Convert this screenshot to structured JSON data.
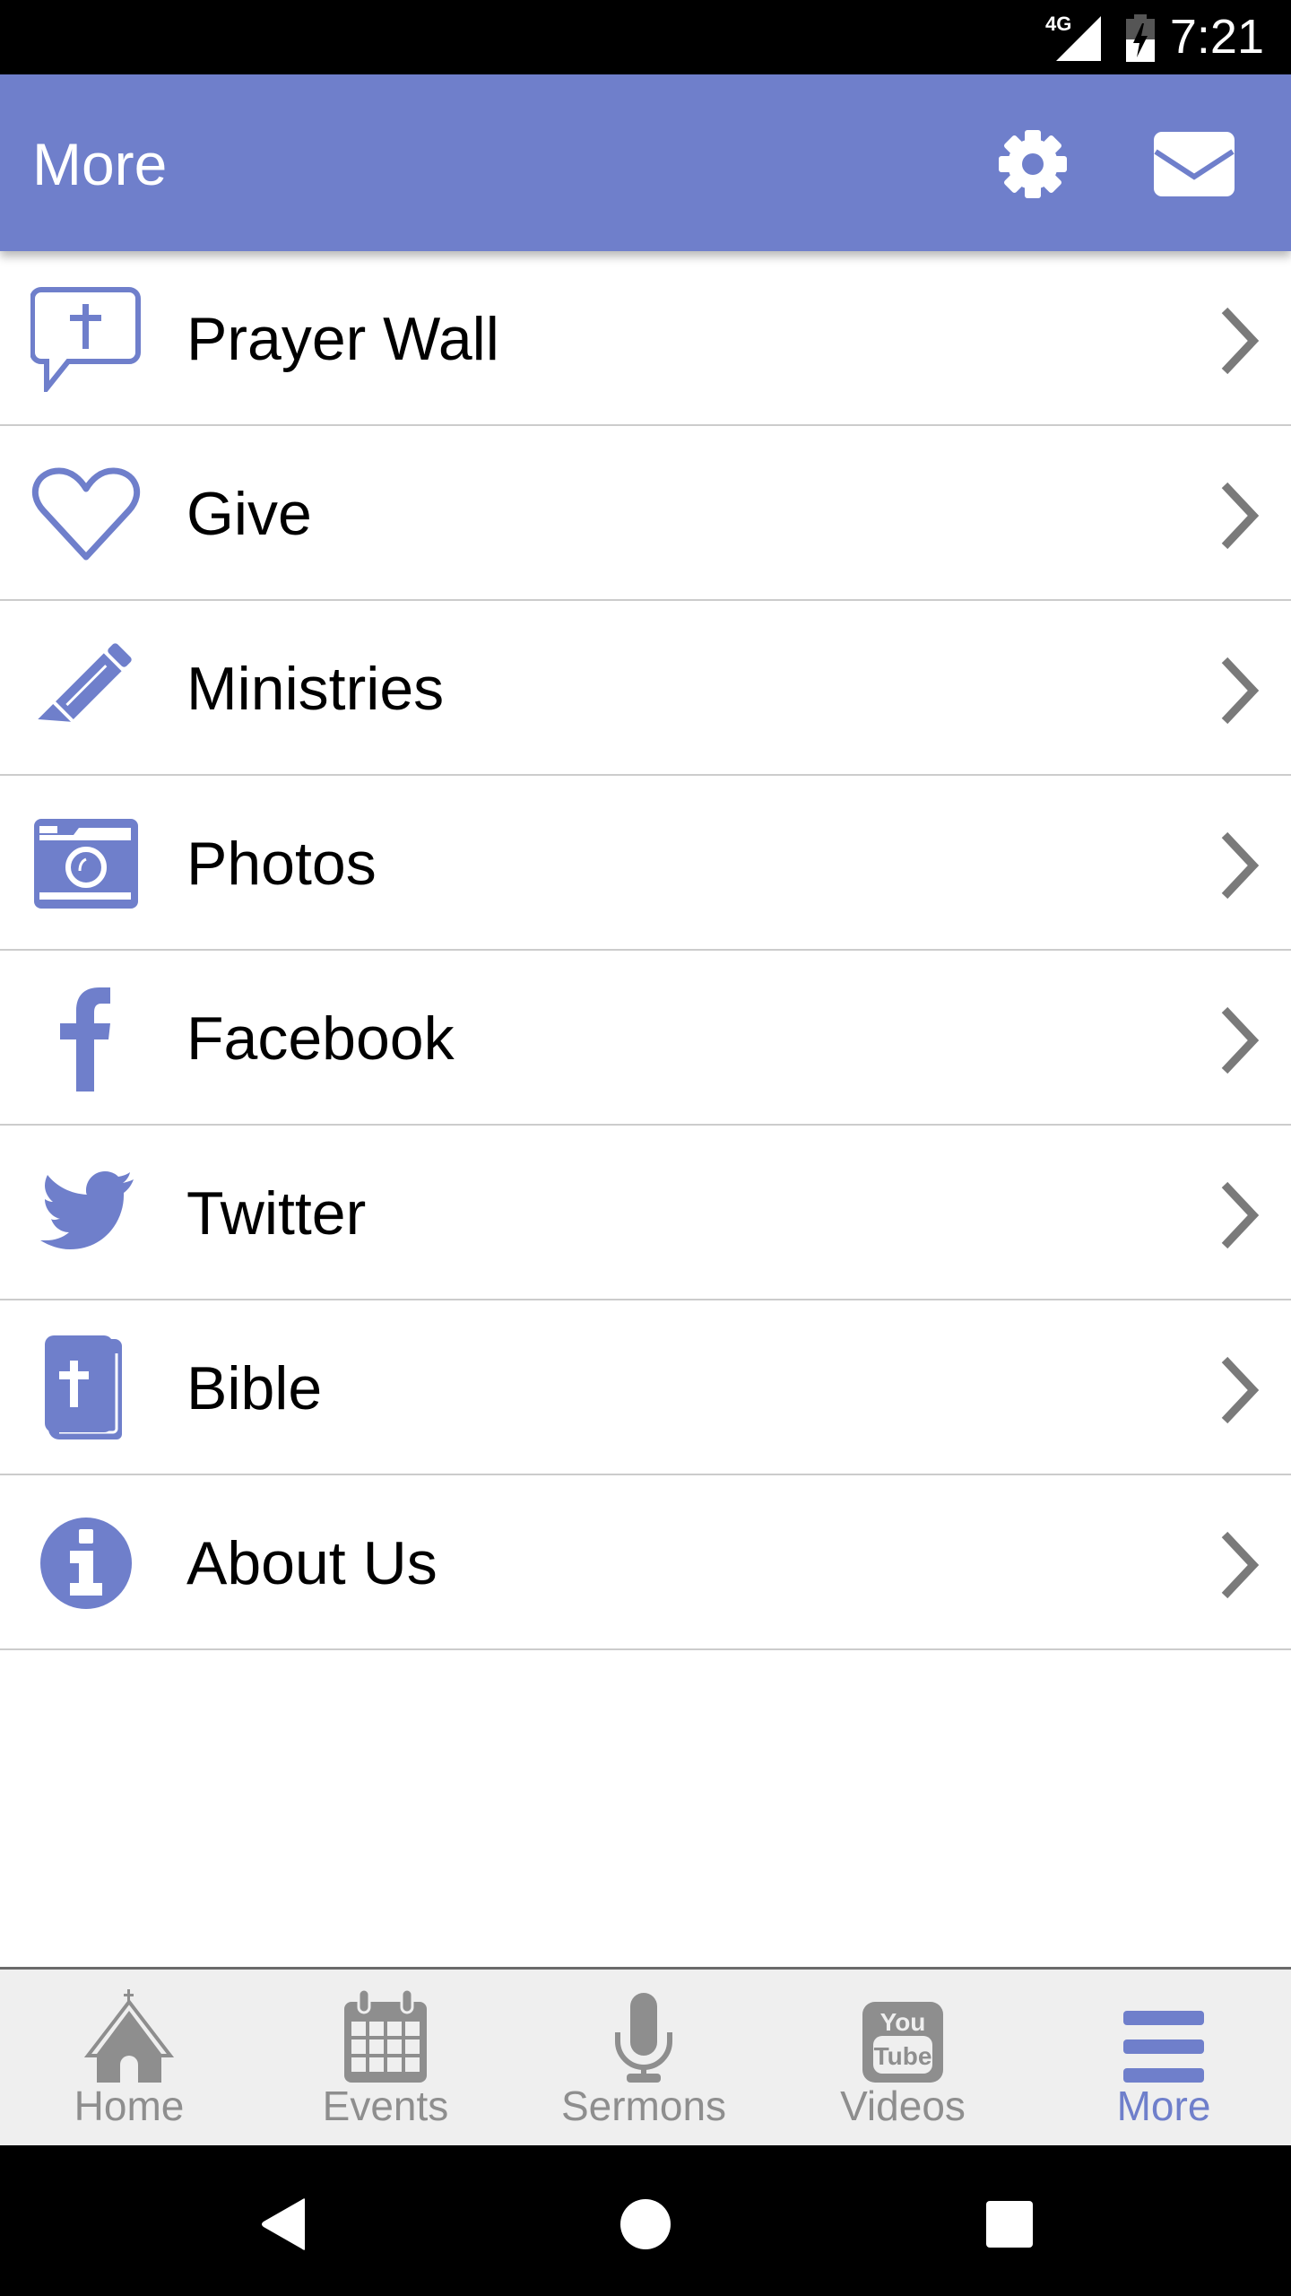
{
  "status_bar": {
    "network": "4G",
    "time": "7:21"
  },
  "app_bar": {
    "title": "More",
    "actions": [
      {
        "name": "settings",
        "icon": "gear-icon"
      },
      {
        "name": "messages",
        "icon": "envelope-icon"
      }
    ]
  },
  "menu": {
    "items": [
      {
        "label": "Prayer Wall",
        "icon": "prayer-speech-bubble-icon"
      },
      {
        "label": "Give",
        "icon": "heart-icon"
      },
      {
        "label": "Ministries",
        "icon": "pencil-icon"
      },
      {
        "label": "Photos",
        "icon": "camera-icon"
      },
      {
        "label": "Facebook",
        "icon": "facebook-icon"
      },
      {
        "label": "Twitter",
        "icon": "twitter-icon"
      },
      {
        "label": "Bible",
        "icon": "bible-icon"
      },
      {
        "label": "About Us",
        "icon": "info-icon"
      }
    ]
  },
  "tab_bar": {
    "active_index": 4,
    "tabs": [
      {
        "label": "Home",
        "icon": "church-icon"
      },
      {
        "label": "Events",
        "icon": "calendar-icon"
      },
      {
        "label": "Sermons",
        "icon": "microphone-icon"
      },
      {
        "label": "Videos",
        "icon": "youtube-icon"
      },
      {
        "label": "More",
        "icon": "menu-icon"
      }
    ]
  },
  "colors": {
    "brand": "#6f7fcb",
    "tab_inactive": "#8e8e8e",
    "chevron": "#7a7a7a",
    "divider": "#cccccc"
  }
}
